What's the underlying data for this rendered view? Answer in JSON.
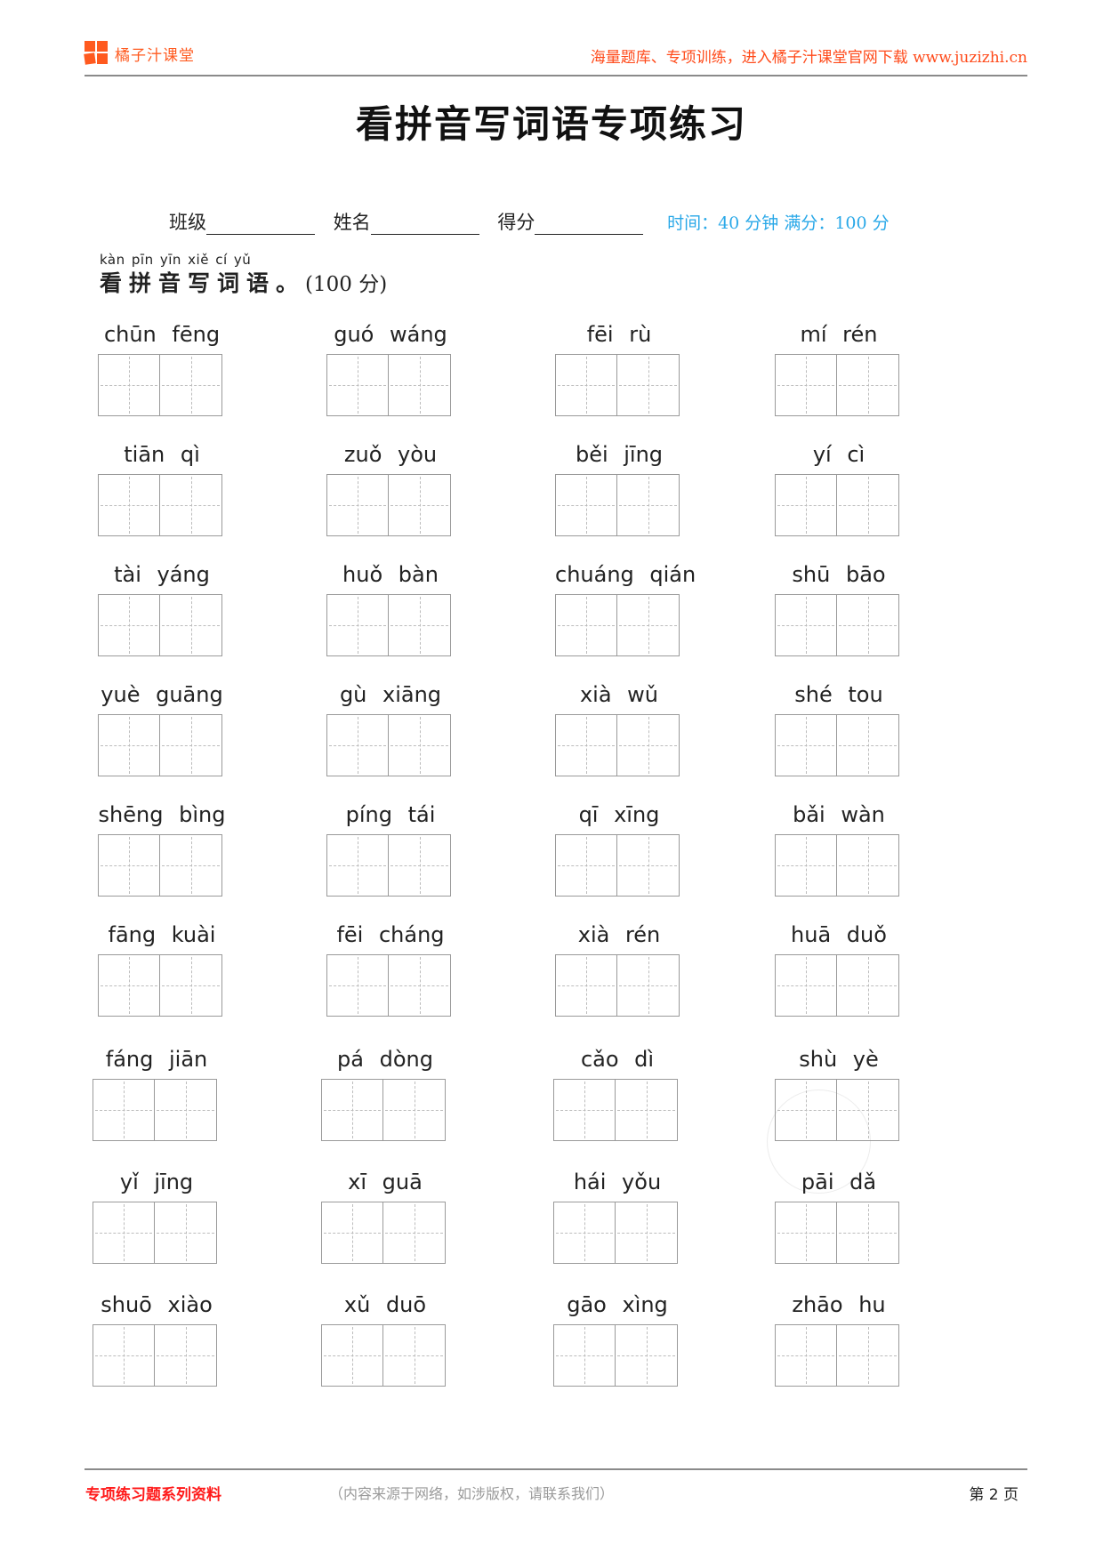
{
  "header": {
    "brand": "橘子汁课堂",
    "slogan": "海量题库、专项训练，进入橘子汁课堂官网下载 www.juzizhi.cn",
    "logo_icon": "orange-squares-logo-icon"
  },
  "title": "看拼音写词语专项练习",
  "info": {
    "class_label": "班级",
    "name_label": "姓名",
    "score_label": "得分",
    "time_meta": "时间：40 分钟  满分：100 分"
  },
  "section": {
    "pinyin": "kàn pīn yīn xiě cí yǔ",
    "heading": "看拼音写词语",
    "punct": "。",
    "score": "(100 分)"
  },
  "items": [
    {
      "pinyin": "chūn fēng"
    },
    {
      "pinyin": "guó wáng"
    },
    {
      "pinyin": "fēi rù"
    },
    {
      "pinyin": "mí rén"
    },
    {
      "pinyin": "tiān qì"
    },
    {
      "pinyin": "zuǒ yòu"
    },
    {
      "pinyin": "běi jīng"
    },
    {
      "pinyin": "yí cì"
    },
    {
      "pinyin": "tài yáng"
    },
    {
      "pinyin": "huǒ bàn"
    },
    {
      "pinyin": "chuáng qián"
    },
    {
      "pinyin": "shū bāo"
    },
    {
      "pinyin": "yuè guāng"
    },
    {
      "pinyin": "gù xiāng"
    },
    {
      "pinyin": "xià wǔ"
    },
    {
      "pinyin": "shé tou"
    },
    {
      "pinyin": "shēng bìng"
    },
    {
      "pinyin": "píng tái"
    },
    {
      "pinyin": "qī xīng"
    },
    {
      "pinyin": "bǎi wàn"
    },
    {
      "pinyin": "fāng kuài"
    },
    {
      "pinyin": "fēi cháng"
    },
    {
      "pinyin": "xià rén"
    },
    {
      "pinyin": "huā duǒ"
    },
    {
      "pinyin": "fáng jiān"
    },
    {
      "pinyin": "pá dòng"
    },
    {
      "pinyin": "cǎo dì"
    },
    {
      "pinyin": "shù yè"
    },
    {
      "pinyin": "yǐ jīng"
    },
    {
      "pinyin": "xī guā"
    },
    {
      "pinyin": "hái yǒu"
    },
    {
      "pinyin": "pāi dǎ"
    },
    {
      "pinyin": "shuō xiào"
    },
    {
      "pinyin": "xǔ duō"
    },
    {
      "pinyin": "gāo xìng"
    },
    {
      "pinyin": "zhāo hu"
    }
  ],
  "footer": {
    "left": "专项练习题系列资料",
    "middle": "（内容来源于网络，如涉版权，请联系我们）",
    "page": "第 2 页"
  }
}
